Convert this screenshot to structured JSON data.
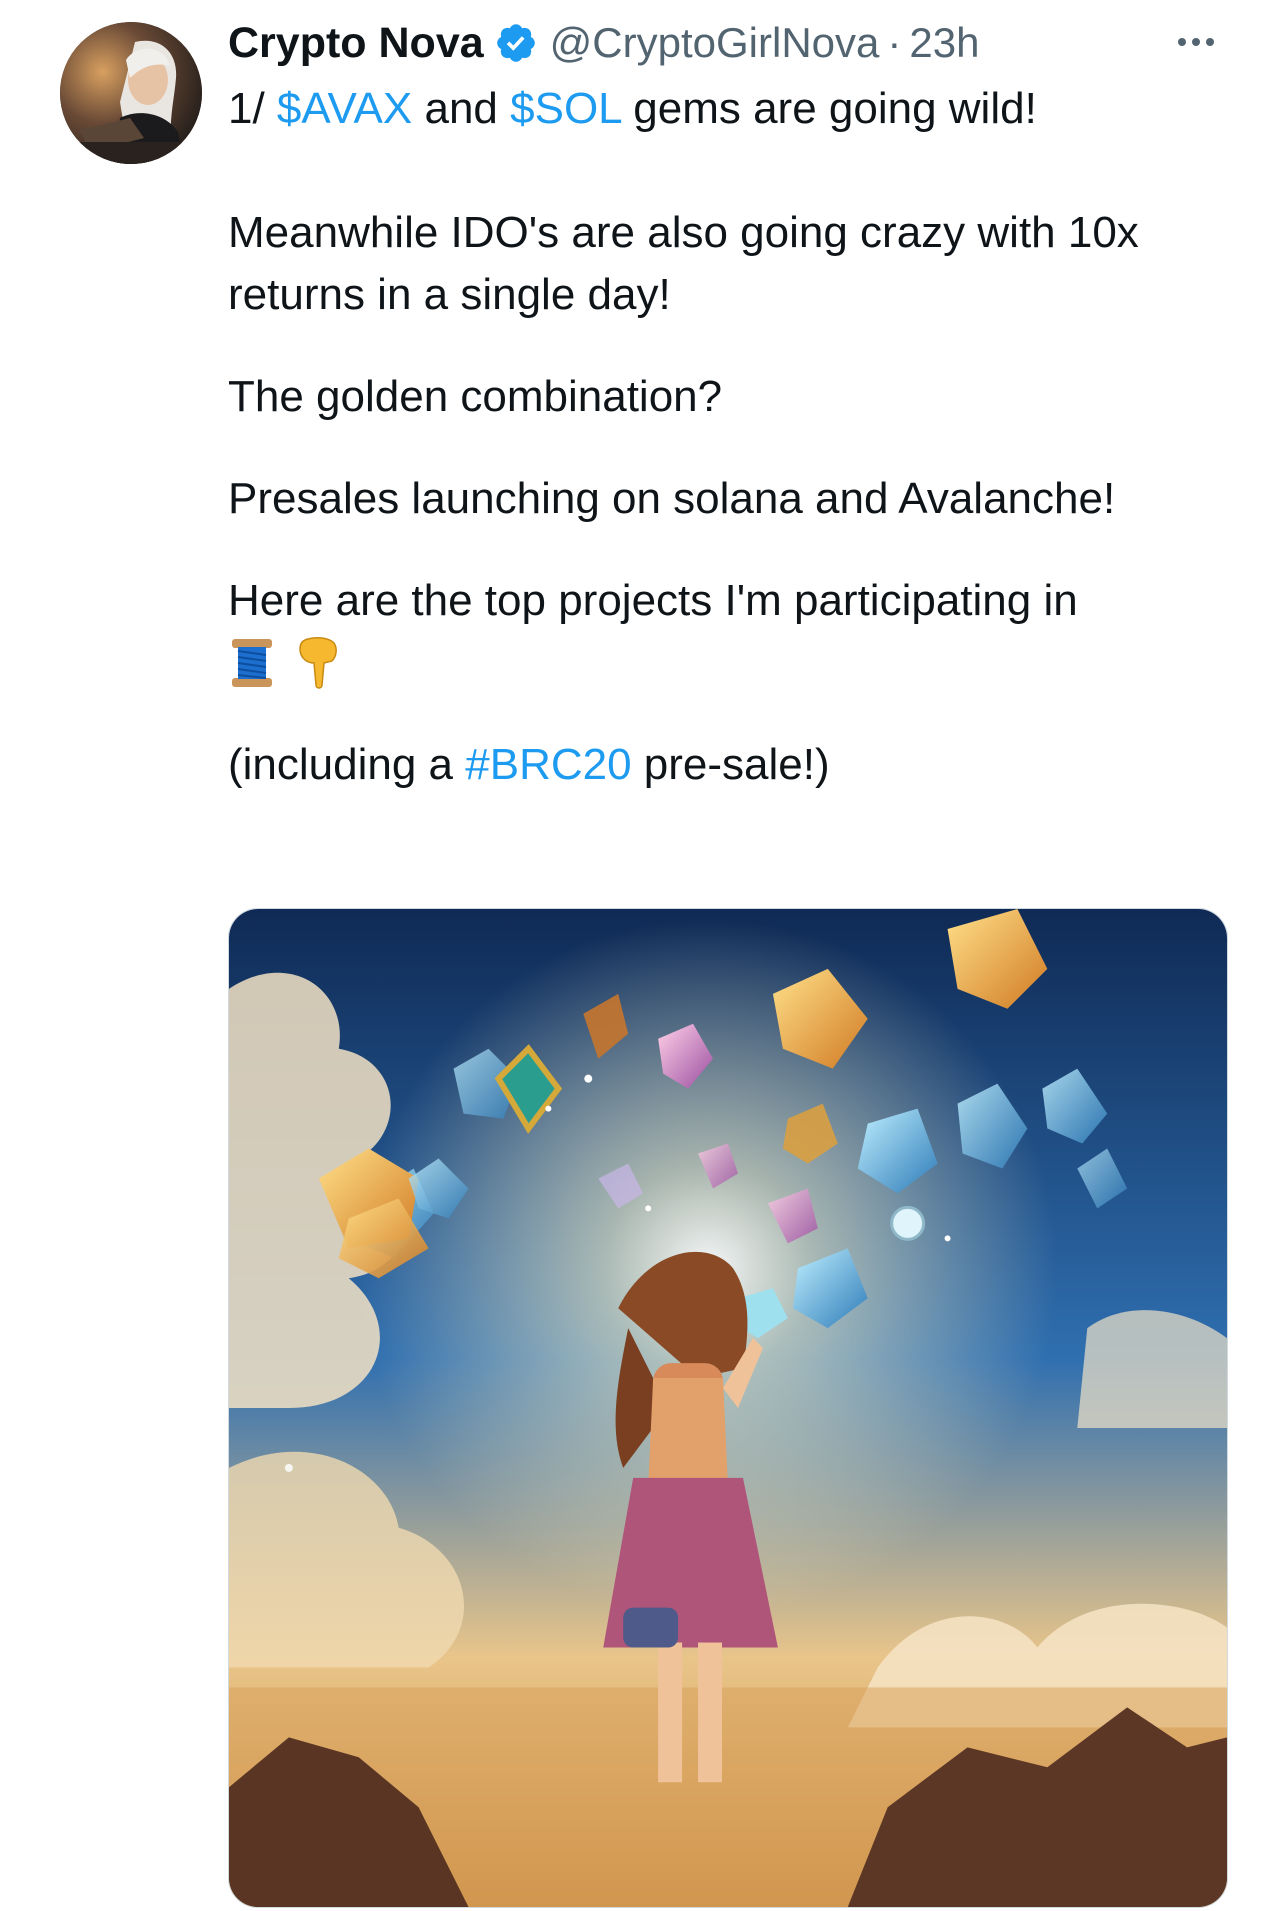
{
  "author": {
    "name": "Crypto Nova",
    "handle": "@CryptoGirlNova",
    "separator": "·",
    "time": "23h"
  },
  "icons": {
    "verified": "verified-badge-icon",
    "more": "more-options-icon",
    "spool": "spool-of-thread-emoji",
    "pointing": "backhand-index-pointing-down-emoji"
  },
  "tweet": {
    "line1_prefix": "1/ ",
    "cashtag1": "$AVAX",
    "line1_and": " and ",
    "cashtag2": "$SOL",
    "line1_suffix": " gems are going wild!",
    "para2": "Meanwhile IDO's are also going crazy with 10x returns in a single day!",
    "para3": "The golden combination?",
    "para4": "Presales launching on solana and Avalanche!",
    "para5": "Here are the top projects I'm participating in",
    "para6_prefix": "(including a ",
    "hashtag": "#BRC20",
    "para6_suffix": " pre-sale!)"
  },
  "colors": {
    "link": "#1d9bf0",
    "text": "#0f1419",
    "secondary": "#536471"
  }
}
